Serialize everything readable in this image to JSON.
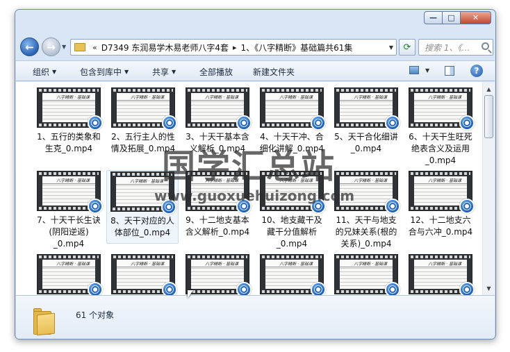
{
  "window": {
    "caption": {
      "minimize": "—",
      "maximize": "□",
      "close": "✕"
    }
  },
  "nav": {
    "back_icon": "←",
    "forward_icon": "→",
    "history_icon": "▼"
  },
  "address": {
    "nav_chevron": "«",
    "crumbs": [
      "D7349 东润易学木易老师八字4套",
      "1、《八字精断》基础篇共61集"
    ],
    "separator": "▸"
  },
  "refresh_icon": "⟳",
  "search": {
    "placeholder": "搜索 1、《…"
  },
  "toolbar": {
    "organize": "组织",
    "include_in_library": "包含到库中",
    "share": "共享",
    "play_all": "全部播放",
    "new_folder": "新建文件夹",
    "help_icon": "?"
  },
  "files": [
    {
      "name": "1、五行的类象和生克_0.mp4",
      "line1": "1、五行的类象和",
      "line2": "生克_0.mp4",
      "line3": ""
    },
    {
      "name": "2、五行主人的性情及拓展_0.mp4",
      "line1": "2、五行主人的性",
      "line2": "情及拓展_0.mp4",
      "line3": ""
    },
    {
      "name": "3、十天干基本含义解析_0.mp4",
      "line1": "3、十天干基本含",
      "line2": "义解析_0.mp4",
      "line3": ""
    },
    {
      "name": "4、十天干冲、合细化讲解_0.mp4",
      "line1": "4、十天干冲、合",
      "line2": "细化讲解_0.mp4",
      "line3": ""
    },
    {
      "name": "5、天干合化细讲_0.mp4",
      "line1": "5、天干合化细讲",
      "line2": "_0.mp4",
      "line3": ""
    },
    {
      "name": "6、十天干生旺死绝表含义及运用_0.mp4",
      "line1": "6、十天干生旺死",
      "line2": "绝表含义及运用",
      "line3": "_0.mp4"
    },
    {
      "name": "7、十天干长生诀(阴阳逆返)_0.mp4",
      "line1": "7、十天干长生诀",
      "line2": "(阴阳逆返)",
      "line3": "_0.mp4"
    },
    {
      "name": "8、天干对应的人体部位_0.mp4",
      "line1": "8、天干对应的人",
      "line2": "体部位_0.mp4",
      "line3": ""
    },
    {
      "name": "9、十二地支基本含义解析_0.mp4",
      "line1": "9、十二地支基本",
      "line2": "含义解析_0.mp4",
      "line3": ""
    },
    {
      "name": "10、地支藏干及藏干分值解析_0.mp4",
      "line1": "10、地支藏干及",
      "line2": "藏干分值解析",
      "line3": "_0.mp4"
    },
    {
      "name": "11、天干与地支的兄妹关系(根的关系)_0.mp4",
      "line1": "11、天干与地支",
      "line2": "的兄妹关系(根的",
      "line3": "关系)_0.mp4"
    },
    {
      "name": "12、十二地支六合与六冲_0.mp4",
      "line1": "12、十二地支六",
      "line2": "合与六冲_0.mp4",
      "line3": ""
    },
    {
      "name": "",
      "line1": "",
      "line2": "",
      "line3": ""
    },
    {
      "name": "",
      "line1": "",
      "line2": "",
      "line3": ""
    },
    {
      "name": "",
      "line1": "",
      "line2": "",
      "line3": ""
    },
    {
      "name": "",
      "line1": "",
      "line2": "",
      "line3": ""
    },
    {
      "name": "",
      "line1": "",
      "line2": "",
      "line3": ""
    },
    {
      "name": "",
      "line1": "",
      "line2": "",
      "line3": ""
    }
  ],
  "thumb_page_title": "八字精断 · 基础课",
  "details": {
    "count": "61 个对象"
  },
  "watermark": {
    "title": "国学汇总站",
    "url": "www.guoxuehuizong.com"
  },
  "colors": {
    "accent": "#2a63b3",
    "window_frame": "#c6d8ef",
    "selection": "#eef5fd"
  }
}
